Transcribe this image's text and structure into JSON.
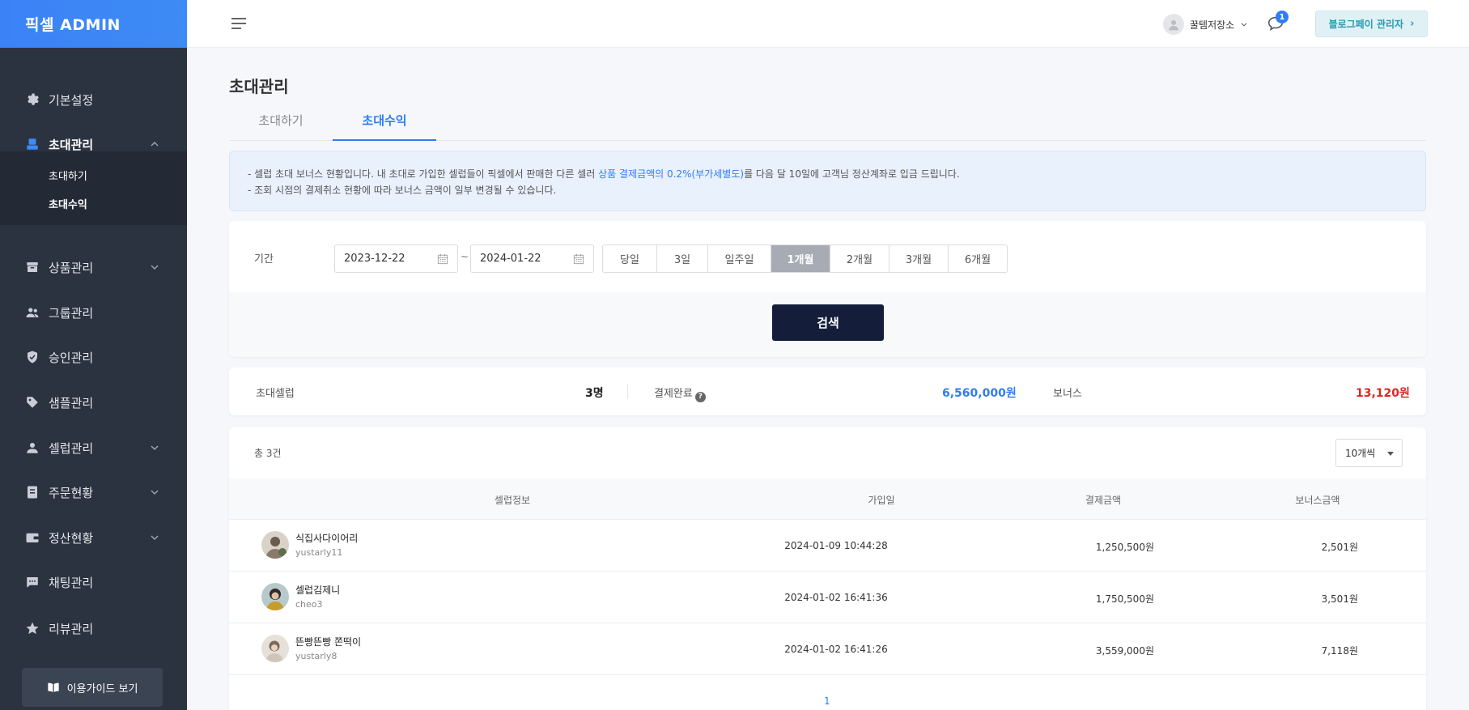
{
  "brand": "픽셀 ADMIN",
  "sidebar": {
    "items": [
      {
        "label": "기본설정"
      },
      {
        "label": "초대관리"
      },
      {
        "label": "상품관리"
      },
      {
        "label": "그룹관리"
      },
      {
        "label": "승인관리"
      },
      {
        "label": "샘플관리"
      },
      {
        "label": "셀럽관리"
      },
      {
        "label": "주문현황"
      },
      {
        "label": "정산현황"
      },
      {
        "label": "채팅관리"
      },
      {
        "label": "리뷰관리"
      }
    ],
    "submenu": [
      "초대하기",
      "초대수익"
    ],
    "guide_button": "이용가이드 보기"
  },
  "header": {
    "user_name": "꿀템저장소",
    "chat_badge": "1",
    "admin_button": "블로그페이 관리자"
  },
  "page": {
    "title": "초대관리",
    "tabs": [
      "초대하기",
      "초대수익"
    ],
    "notice": {
      "line1_prefix": "- 셀럽 초대 보너스 현황입니다. 내 초대로 가입한 셀럽들이 픽셀에서 판매한 다른 셀러 ",
      "line1_highlight": "상품 결제금액의 0.2%(부가세별도)",
      "line1_suffix": "를 다음 달 10일에 고객님 정산계좌로 입금 드립니다.",
      "line2": "- 조회 시점의 결제취소 현황에 따라 보너스 금액이 일부 변경될 수 있습니다."
    }
  },
  "filter": {
    "label": "기간",
    "start_date": "2023-12-22",
    "end_date": "2024-01-22",
    "separator": "~",
    "periods": [
      "당일",
      "3일",
      "일주일",
      "1개월",
      "2개월",
      "3개월",
      "6개월"
    ],
    "active_period": "1개월",
    "search_button": "검색"
  },
  "summary": {
    "invited_label": "초대셀럽",
    "invited_value": "3명",
    "paid_label": "결제완료",
    "paid_value": "6,560,000원",
    "bonus_label": "보너스",
    "bonus_value": "13,120원"
  },
  "list": {
    "total": "총 3건",
    "per_page": "10개씩",
    "columns": [
      "셀럽정보",
      "가입일",
      "결제금액",
      "보너스금액"
    ],
    "rows": [
      {
        "name": "식집사다이어리",
        "id": "yustarly11",
        "date": "2024-01-09 10:44:28",
        "amount": "1,250,500원",
        "bonus": "2,501원"
      },
      {
        "name": "셀럽김제니",
        "id": "cheo3",
        "date": "2024-01-02 16:41:36",
        "amount": "1,750,500원",
        "bonus": "3,501원"
      },
      {
        "name": "뜬빵뜬빵 쫀떡이",
        "id": "yustarly8",
        "date": "2024-01-02 16:41:26",
        "amount": "3,559,000원",
        "bonus": "7,118원"
      }
    ],
    "page": "1"
  },
  "colors": {
    "accent": "#2f7df6",
    "sidebar_bg": "#2b3340",
    "search_button": "#141d3a",
    "bonus": "#e02424"
  }
}
